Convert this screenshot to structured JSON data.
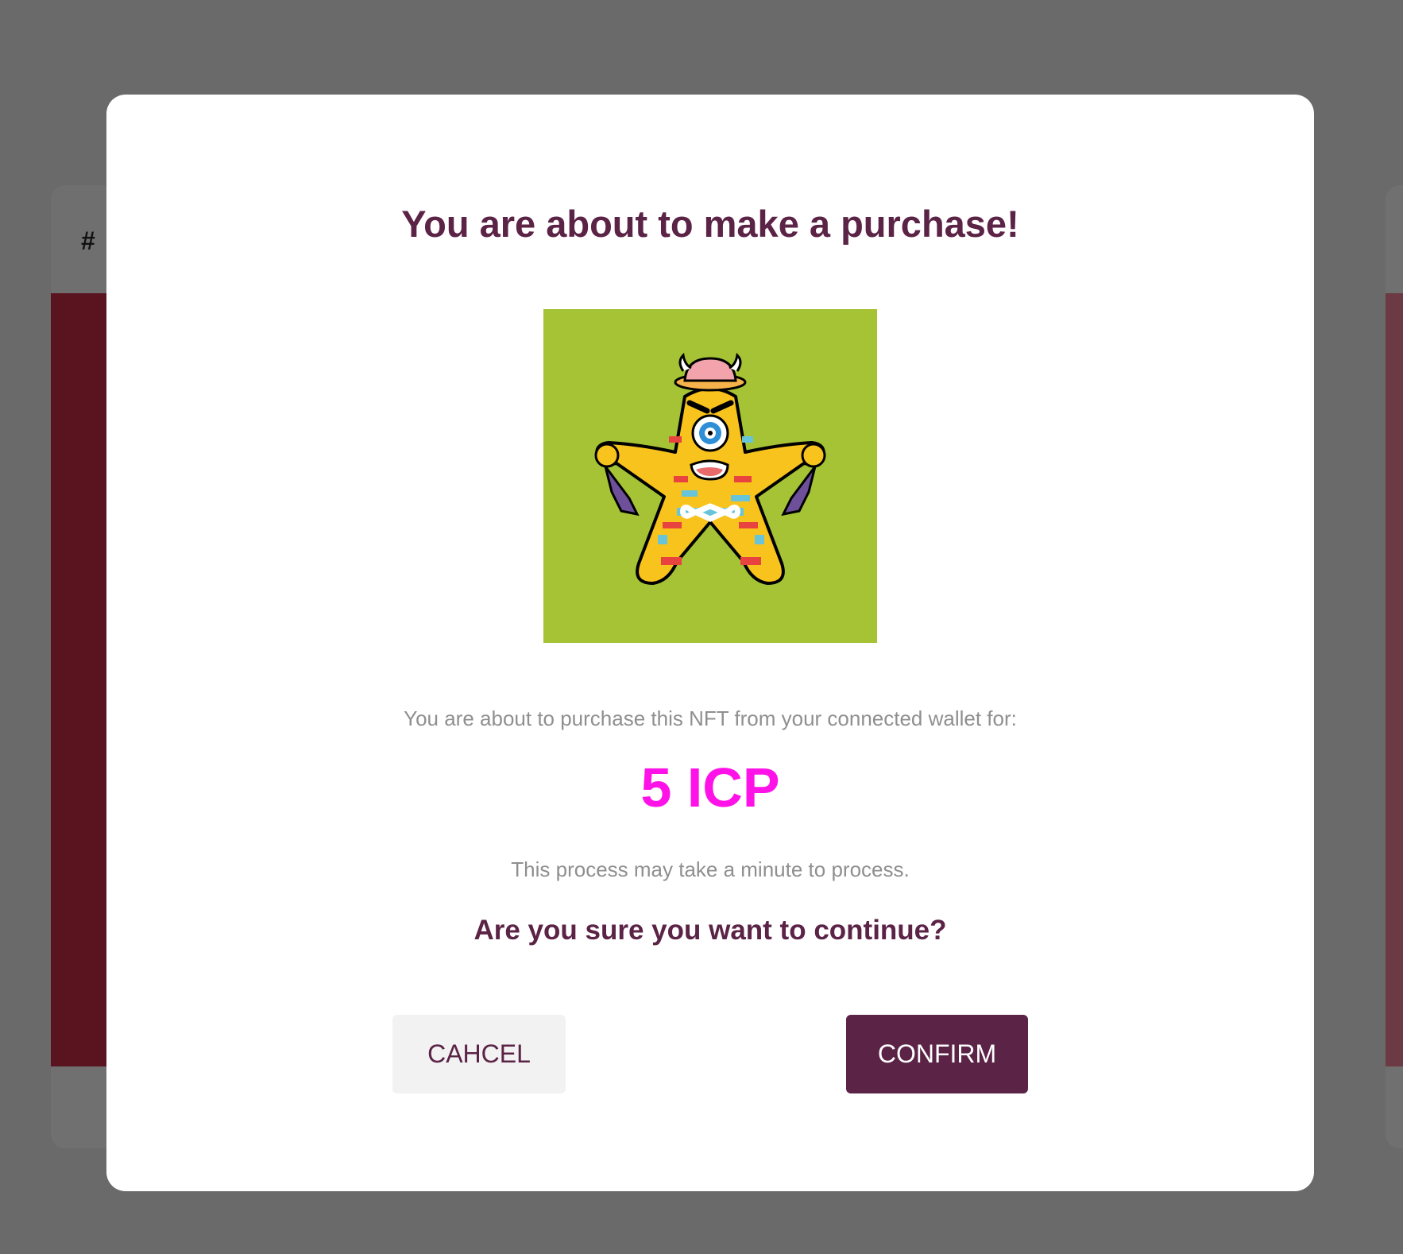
{
  "background": {
    "card_header_label": "# "
  },
  "modal": {
    "title": "You are about to make a purchase!",
    "nft_image_alt": "NFT character artwork",
    "purchase_text": "You are about to purchase this NFT from your connected wallet for:",
    "price": "5 ICP",
    "process_text": "This process may take a minute to process.",
    "confirm_question": "Are you sure you want to continue?",
    "cancel_label": "CAHCEL",
    "confirm_label": "CONFIRM"
  },
  "colors": {
    "backdrop": "#6a6a6a",
    "primary": "#5b2346",
    "price": "#ff12e8",
    "nft_background": "#a6c235"
  }
}
